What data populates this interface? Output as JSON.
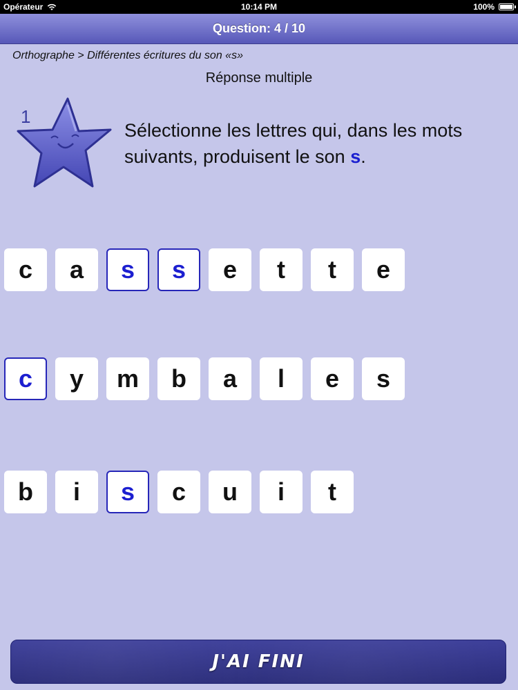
{
  "status": {
    "carrier": "Opérateur",
    "time": "10:14 PM",
    "battery": "100%"
  },
  "header": {
    "title": "Question: 4 / 10"
  },
  "breadcrumb": "Orthographe > Différentes écritures du son  «s»",
  "question_type": "Réponse multiple",
  "star": {
    "number": "1"
  },
  "instruction": {
    "text": "Sélectionne les lettres qui, dans les mots suivants, produisent le son",
    "sound": "s",
    "end": "."
  },
  "words": [
    {
      "word": "cassette",
      "letters": [
        "c",
        "a",
        "s",
        "s",
        "e",
        "t",
        "t",
        "e"
      ],
      "selected": [
        false,
        false,
        true,
        true,
        false,
        false,
        false,
        false
      ]
    },
    {
      "word": "cymbales",
      "letters": [
        "c",
        "y",
        "m",
        "b",
        "a",
        "l",
        "e",
        "s"
      ],
      "selected": [
        true,
        false,
        false,
        false,
        false,
        false,
        false,
        false
      ]
    },
    {
      "word": "biscuit",
      "letters": [
        "b",
        "i",
        "s",
        "c",
        "u",
        "i",
        "t"
      ],
      "selected": [
        false,
        false,
        true,
        false,
        false,
        false,
        false
      ]
    }
  ],
  "finish_button": {
    "label": "J'AI FINI"
  },
  "colors": {
    "background": "#c5c6ea",
    "header": "#6a6bc8",
    "selected": "#1c1fd0",
    "button": "#2f3183"
  }
}
